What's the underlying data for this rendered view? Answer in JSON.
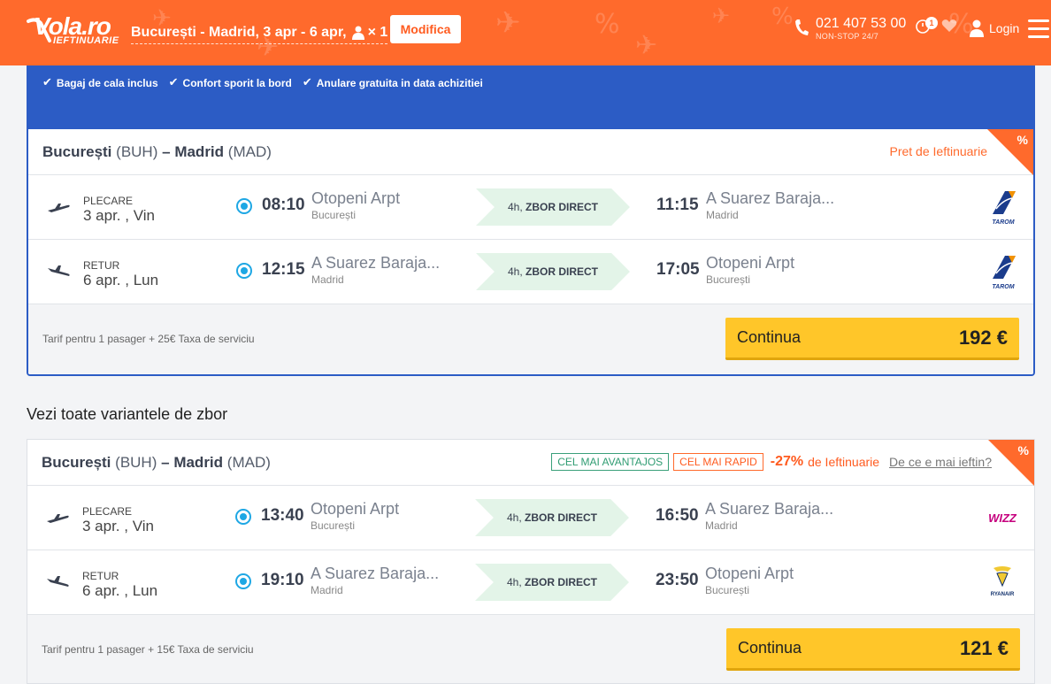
{
  "header": {
    "logo_brand": "Vola.ro",
    "logo_tagline": "IEFTINUARIE",
    "route": "București - Madrid, 3 apr - 6 apr,",
    "passengers": "× 1",
    "modify_label": "Modifica",
    "phone_number": "021 407 53 00",
    "phone_sub": "NON-STOP 24/7",
    "notification_count": "1",
    "login_label": "Login",
    "accent_color": "#ff6a2c"
  },
  "perks": [
    "Bagaj de cala inclus",
    "Confort sporit la bord",
    "Anulare gratuita in data achizitiei"
  ],
  "section_title": "Vezi toate variantele de zbor",
  "offers": [
    {
      "origin": "București",
      "origin_code": "(BUH)",
      "dash": "–",
      "destination": "Madrid",
      "destination_code": "(MAD)",
      "promo_label": "Pret de Ieftinuarie",
      "corner_symbol": "%",
      "legs": [
        {
          "direction": "PLECARE",
          "date": "3 apr. , Vin",
          "dep_time": "08:10",
          "dep_airport": "Otopeni Arpt",
          "dep_city": "București",
          "duration": "4h,",
          "flight_type": "ZBOR DIRECT",
          "arr_time": "11:15",
          "arr_airport": "A Suarez Baraja...",
          "arr_city": "Madrid",
          "airline": "TAROM"
        },
        {
          "direction": "RETUR",
          "date": "6 apr. , Lun",
          "dep_time": "12:15",
          "dep_airport": "A Suarez Baraja...",
          "dep_city": "Madrid",
          "duration": "4h,",
          "flight_type": "ZBOR DIRECT",
          "arr_time": "17:05",
          "arr_airport": "Otopeni Arpt",
          "arr_city": "București",
          "airline": "TAROM"
        }
      ],
      "fare_note": "Tarif pentru 1 pasager + 25€ Taxa de serviciu",
      "cta_label": "Continua",
      "price": "192 €"
    },
    {
      "origin": "București",
      "origin_code": "(BUH)",
      "dash": "–",
      "destination": "Madrid",
      "destination_code": "(MAD)",
      "tag_best": "CEL MAI AVANTAJOS",
      "tag_fast": "CEL MAI RAPID",
      "discount": "-27%",
      "discount_text": "de Ieftinuarie",
      "why_link": "De ce e mai ieftin?",
      "corner_symbol": "%",
      "legs": [
        {
          "direction": "PLECARE",
          "date": "3 apr. , Vin",
          "dep_time": "13:40",
          "dep_airport": "Otopeni Arpt",
          "dep_city": "București",
          "duration": "4h,",
          "flight_type": "ZBOR DIRECT",
          "arr_time": "16:50",
          "arr_airport": "A Suarez Baraja...",
          "arr_city": "Madrid",
          "airline": "WIZZ"
        },
        {
          "direction": "RETUR",
          "date": "6 apr. , Lun",
          "dep_time": "19:10",
          "dep_airport": "A Suarez Baraja...",
          "dep_city": "Madrid",
          "duration": "4h,",
          "flight_type": "ZBOR DIRECT",
          "arr_time": "23:50",
          "arr_airport": "Otopeni Arpt",
          "arr_city": "București",
          "airline": "RYANAIR"
        }
      ],
      "fare_note": "Tarif pentru 1 pasager + 15€ Taxa de serviciu",
      "cta_label": "Continua",
      "price": "121 €"
    }
  ]
}
